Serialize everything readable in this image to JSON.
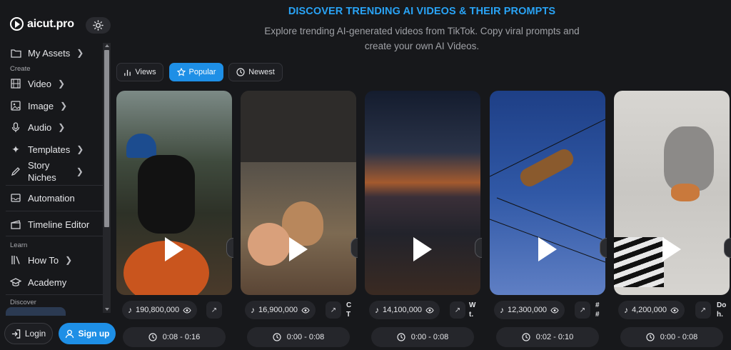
{
  "brand": {
    "name": "aicut.pro"
  },
  "sidebar": {
    "my_assets": "My Assets",
    "create_label": "Create",
    "video": "Video",
    "image": "Image",
    "audio": "Audio",
    "templates": "Templates",
    "story_niches_1": "Story",
    "story_niches_2": "Niches",
    "automation": "Automation",
    "timeline_editor": "Timeline Editor",
    "learn_label": "Learn",
    "how_to": "How To",
    "academy": "Academy",
    "discover_label": "Discover"
  },
  "auth": {
    "login": "Login",
    "signup": "Sign up"
  },
  "header": {
    "title": "DISCOVER TRENDING AI VIDEOS & THEIR PROMPTS",
    "subtitle_line1": "Explore trending AI-generated videos from TikTok. Copy viral prompts and",
    "subtitle_line2": "create your own AI Videos."
  },
  "filters": {
    "views": "Views",
    "popular": "Popular",
    "newest": "Newest",
    "active": "Popular"
  },
  "cards": [
    {
      "views": "190,800,000",
      "time": "0:08 - 0:16",
      "peek": ""
    },
    {
      "views": "16,900,000",
      "time": "0:00 - 0:08",
      "peek": "C T"
    },
    {
      "views": "14,100,000",
      "time": "0:00 - 0:08",
      "peek": "W t."
    },
    {
      "views": "12,300,000",
      "time": "0:02 - 0:10",
      "peek": "# #"
    },
    {
      "views": "4,200,000",
      "time": "0:00 - 0:08",
      "peek": "Do h."
    }
  ],
  "colors": {
    "accent": "#1e8fe6",
    "title_blue": "#29a3f5",
    "background": "#17181b"
  }
}
